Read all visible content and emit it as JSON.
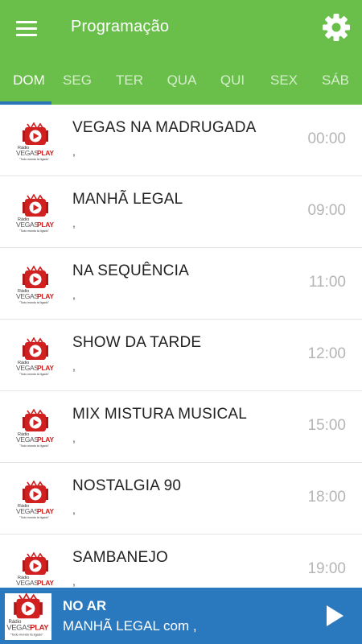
{
  "header": {
    "title": "Programação",
    "menu_icon": "hamburger-menu-icon",
    "settings_icon": "gear-icon"
  },
  "tabs": [
    {
      "label": "DOM",
      "active": true
    },
    {
      "label": "SEG"
    },
    {
      "label": "TER"
    },
    {
      "label": "QUA"
    },
    {
      "label": "QUI"
    },
    {
      "label": "SEX"
    },
    {
      "label": "SÁB"
    }
  ],
  "logo": {
    "line1": "Rádio",
    "brand_a": "VEGAS",
    "brand_b": "PLAY",
    "tagline": "Todo mundo tá ligado!"
  },
  "programs": [
    {
      "name": "VEGAS NA MADRUGADA",
      "host": ",",
      "time": "00:00"
    },
    {
      "name": "MANHÃ LEGAL",
      "host": ",",
      "time": "09:00"
    },
    {
      "name": "NA SEQUÊNCIA",
      "host": ",",
      "time": "11:00"
    },
    {
      "name": "SHOW DA TARDE",
      "host": ",",
      "time": "12:00"
    },
    {
      "name": "MIX MISTURA MUSICAL",
      "host": ",",
      "time": "15:00"
    },
    {
      "name": "NOSTALGIA 90",
      "host": ",",
      "time": "18:00"
    },
    {
      "name": "SAMBANEJO",
      "host": ",",
      "time": "19:00"
    }
  ],
  "player": {
    "label": "NO AR",
    "now_playing": "MANHÃ LEGAL com ,",
    "play_icon": "play-icon"
  },
  "colors": {
    "appbar": "#6abf4b",
    "player": "#2a78be",
    "indicator": "#2a74b8",
    "logo_red": "#d02020"
  }
}
